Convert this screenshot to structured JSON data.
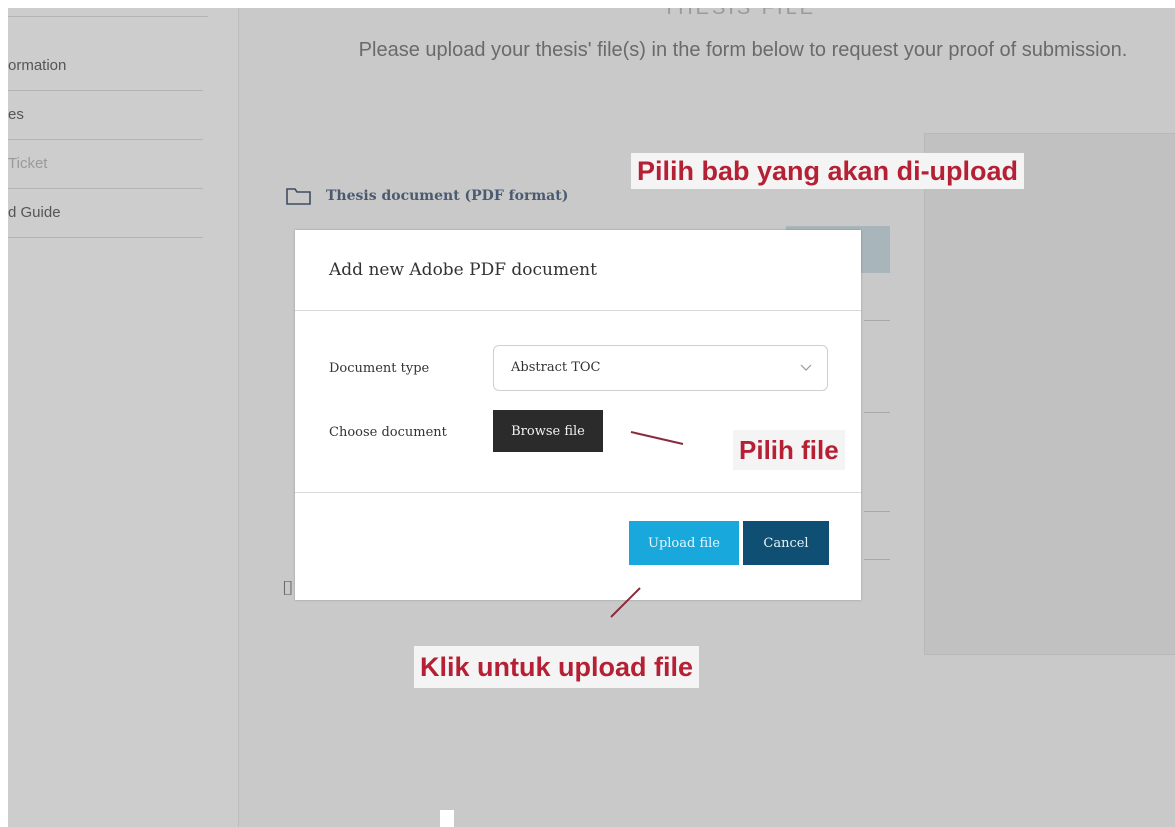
{
  "sidebar": {
    "items": [
      {
        "label": "ormation",
        "state": "normal"
      },
      {
        "label": "es",
        "state": "normal"
      },
      {
        "label": "Ticket",
        "state": "dim"
      },
      {
        "label": "d Guide",
        "state": "normal"
      }
    ]
  },
  "page": {
    "heading_cut": "THESIS FILE",
    "intro": "Please upload your thesis' file(s) in the form below to request your proof of submission.",
    "section_title": "Thesis document (PDF format)"
  },
  "modal": {
    "title": "Add new Adobe PDF document",
    "document_type_label": "Document type",
    "document_type_value": "Abstract TOC",
    "choose_document_label": "Choose document",
    "browse_button": "Browse file",
    "upload_button": "Upload file",
    "cancel_button": "Cancel"
  },
  "annotations": {
    "choose_chapter": "Pilih bab yang akan di-upload",
    "choose_file": "Pilih file",
    "click_upload": "Klik untuk upload file"
  },
  "colors": {
    "annotation_text": "#b62035",
    "upload_button": "#19a8dc",
    "cancel_button": "#0e4f73",
    "browse_button": "#2b2b2b"
  },
  "icons": [
    "folder-icon",
    "chevron-down-icon"
  ]
}
